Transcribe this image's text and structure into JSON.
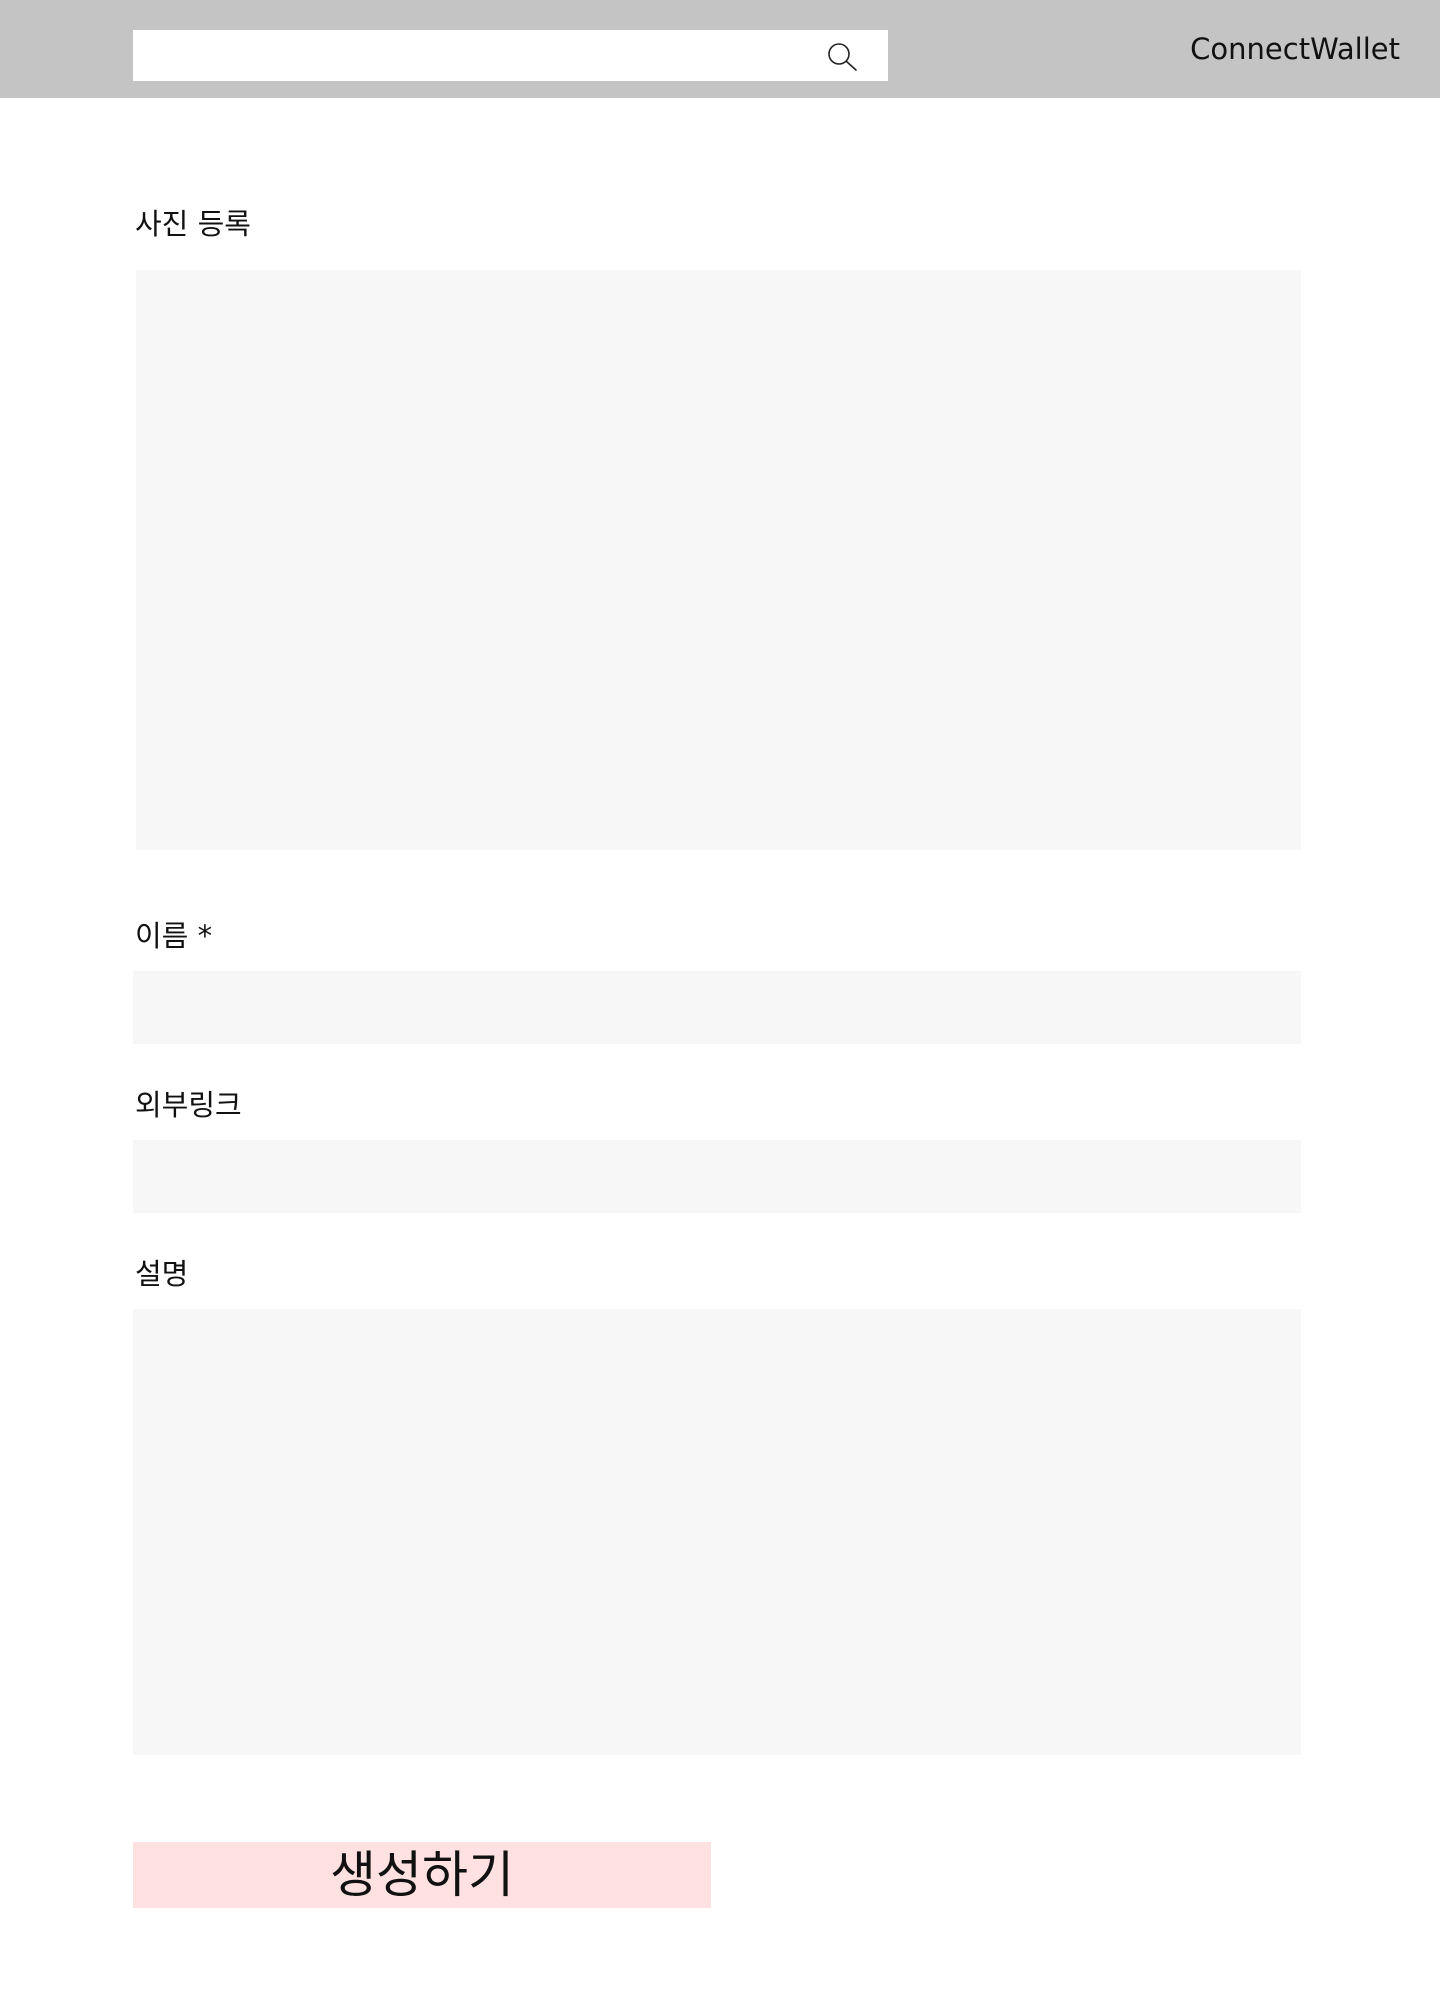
{
  "header": {
    "search": {
      "value": "",
      "placeholder": ""
    },
    "search_icon": "search-icon",
    "connect_wallet_label": "ConnectWallet"
  },
  "form": {
    "photo_label": "사진 등록",
    "name_label": "이름 *",
    "name_value": "",
    "link_label": "외부링크",
    "link_value": "",
    "description_label": "설명",
    "description_value": "",
    "submit_label": "생성하기"
  },
  "colors": {
    "header_bg": "#c4c4c4",
    "field_bg": "#f7f7f7",
    "submit_bg": "#ffe1e1"
  }
}
